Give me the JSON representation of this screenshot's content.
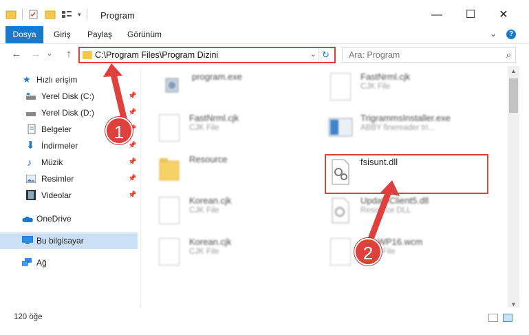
{
  "window": {
    "title": "Program",
    "controls": {
      "minimize": "—",
      "maximize": "☐",
      "close": "✕"
    }
  },
  "ribbon": {
    "tabs": [
      "Dosya",
      "Giriş",
      "Paylaş",
      "Görünüm"
    ],
    "expand": "⌄",
    "help": "?"
  },
  "nav": {
    "back": "←",
    "forward": "→",
    "recent": "⌄",
    "up": "↑",
    "address": "C:\\Program Files\\Program Dizini",
    "address_dropdown": "⌄",
    "refresh": "↻",
    "search_placeholder": "Ara: Program",
    "search_icon": "⌕"
  },
  "sidebar": {
    "items": [
      {
        "label": "Hızlı erişim",
        "icon": "star-icon",
        "color": "#1979ca"
      },
      {
        "label": "Yerel Disk (C:)",
        "icon": "drive-c-icon",
        "pinned": true
      },
      {
        "label": "Yerel Disk (D:)",
        "icon": "drive-d-icon",
        "pinned": true
      },
      {
        "label": "Belgeler",
        "icon": "documents-icon",
        "pinned": true
      },
      {
        "label": "İndirmeler",
        "icon": "downloads-icon",
        "pinned": true
      },
      {
        "label": "Müzik",
        "icon": "music-icon",
        "pinned": true
      },
      {
        "label": "Resimler",
        "icon": "pictures-icon",
        "pinned": true
      },
      {
        "label": "Videolar",
        "icon": "videos-icon",
        "pinned": true
      },
      {
        "label": "OneDrive",
        "icon": "onedrive-icon"
      },
      {
        "label": "Bu bilgisayar",
        "icon": "this-pc-icon",
        "selected": true
      },
      {
        "label": "Ağ",
        "icon": "network-icon"
      }
    ],
    "pin_glyph": "📌"
  },
  "files": [
    {
      "name": "program.exe",
      "type": "",
      "icon": "exe-icon"
    },
    {
      "name": "FastNrml.cjk",
      "type": "CJK File",
      "icon": "file-icon"
    },
    {
      "name": "FastNrml.cjk",
      "type": "CJK File",
      "icon": "file-icon"
    },
    {
      "name": "TrigrammsInstaller.exe",
      "type": "ABBY finereader tri...",
      "icon": "installer-icon"
    },
    {
      "name": "Resource",
      "type": "",
      "icon": "folder-icon"
    },
    {
      "name": "fsisunt.dll",
      "type": "",
      "icon": "dll-gear-icon"
    },
    {
      "name": "Korean.cjk",
      "type": "CJK File",
      "icon": "file-icon"
    },
    {
      "name": "UpdateClient5.dll",
      "type": "Resource DLL",
      "icon": "dll-gear-icon"
    },
    {
      "name": "Korean.cjk",
      "type": "CJK File",
      "icon": "file-icon"
    },
    {
      "name": "...ToWP16.wcm",
      "type": "WCM File",
      "icon": "file-icon"
    }
  ],
  "status": {
    "count": "120 öğe"
  },
  "annotations": {
    "badge1": "1",
    "badge2": "2",
    "color": "#e0403c"
  }
}
